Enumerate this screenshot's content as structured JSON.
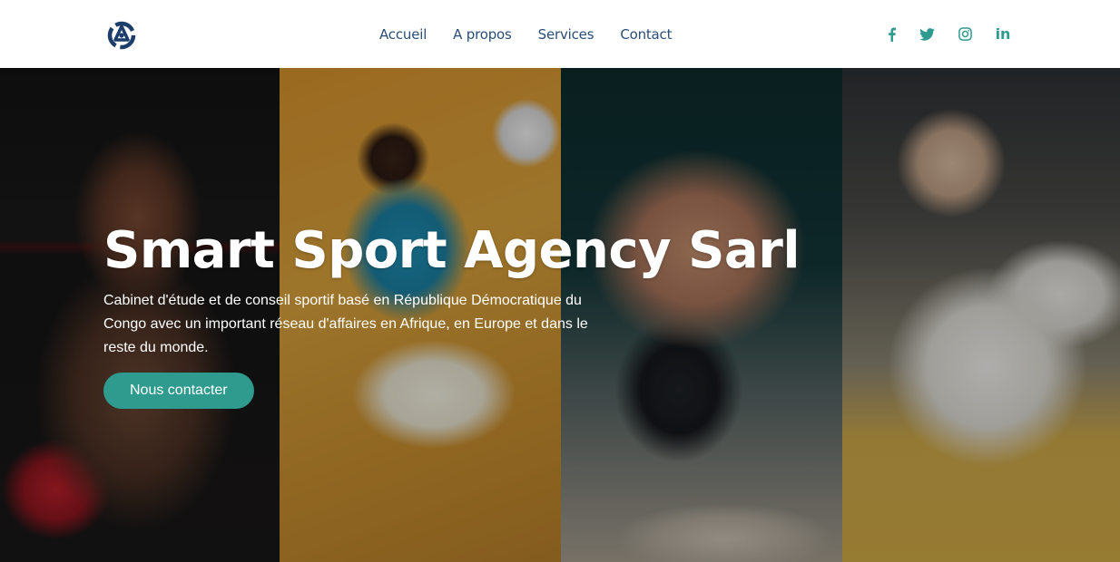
{
  "nav": {
    "links": [
      {
        "label": "Accueil"
      },
      {
        "label": "A propos"
      },
      {
        "label": "Services"
      },
      {
        "label": "Contact"
      }
    ]
  },
  "socials": [
    {
      "icon": "facebook-icon"
    },
    {
      "icon": "twitter-icon"
    },
    {
      "icon": "instagram-icon"
    },
    {
      "icon": "linkedin-icon",
      "glyph": "in"
    }
  ],
  "hero": {
    "title": "Smart Sport Agency Sarl",
    "description": "Cabinet d'étude et de conseil sportif basé en République Démocratique du Congo avec un important réseau d'affaires en Afrique, en Europe et dans le reste du monde.",
    "cta_label": "Nous contacter",
    "images": [
      {
        "subject": "boxer-photo"
      },
      {
        "subject": "football-player-photo"
      },
      {
        "subject": "wrestling-photo"
      },
      {
        "subject": "judo-kids-photo"
      }
    ]
  },
  "colors": {
    "nav_link": "#2a4d78",
    "accent": "#2e9b8e",
    "logo": "#1d3e6b"
  }
}
